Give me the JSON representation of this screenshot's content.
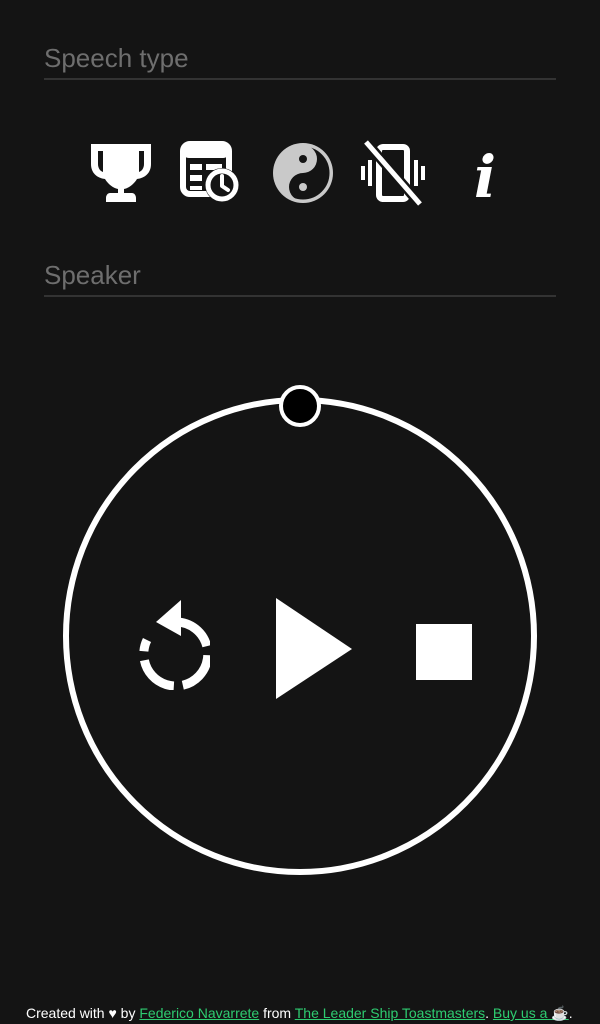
{
  "form": {
    "speech_type_placeholder": "Speech type",
    "speaker_placeholder": "Speaker"
  },
  "toolbar": {
    "icons": [
      "trophy-icon",
      "schedule-icon",
      "yin-yang-icon",
      "vibration-off-icon",
      "info-icon"
    ],
    "info_glyph": "i"
  },
  "timer": {
    "progress": 0,
    "controls": [
      "restart-icon",
      "play-icon",
      "stop-icon"
    ]
  },
  "footer": {
    "prefix": "Created with ",
    "heart": "♥",
    "by": " by ",
    "author": "Federico Navarrete",
    "from": " from ",
    "club": "The Leader Ship Toastmasters",
    "sep": ". ",
    "buy": "Buy us a ☕",
    "end": "."
  },
  "colors": {
    "background": "#141414",
    "foreground": "#ffffff",
    "link": "#2ecc71",
    "placeholder": "#6e6e6e",
    "field_border": "#333333"
  }
}
